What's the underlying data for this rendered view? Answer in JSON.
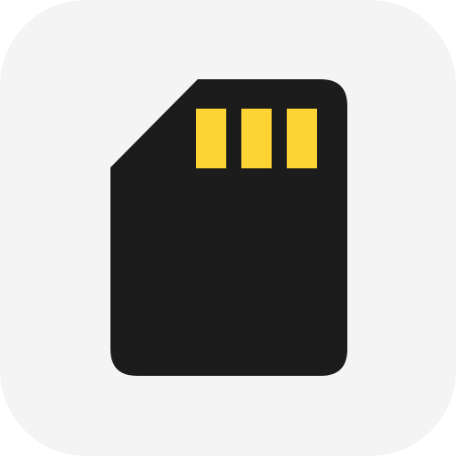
{
  "app_icon": {
    "icon": "sd-card-icon",
    "colors": {
      "tile_background": "#f4f4f4",
      "card_body": "#1c1c1c",
      "contacts": "#fdd434"
    },
    "contact_count": 3
  }
}
